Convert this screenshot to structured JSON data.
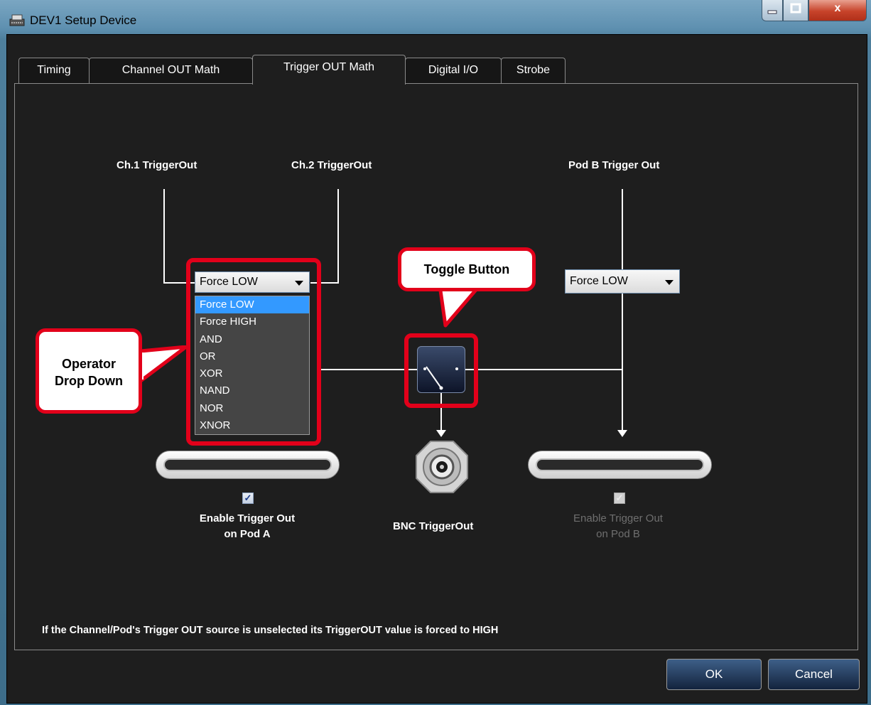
{
  "window": {
    "title": "DEV1 Setup Device",
    "close_label": "x"
  },
  "tabs": [
    {
      "label": "Timing"
    },
    {
      "label": "Channel OUT Math"
    },
    {
      "label": "Trigger OUT Math"
    },
    {
      "label": "Digital I/O"
    },
    {
      "label": "Strobe"
    }
  ],
  "active_tab": "Trigger OUT Math",
  "diagram": {
    "ch1_label": "Ch.1 TriggerOut",
    "ch2_label": "Ch.2 TriggerOut",
    "podb_label": "Pod B Trigger Out",
    "pod_a_operator": {
      "selected": "Force LOW",
      "options": [
        "Force LOW",
        "Force HIGH",
        "AND",
        "OR",
        "XOR",
        "NAND",
        "NOR",
        "XNOR"
      ]
    },
    "pod_b_operator": {
      "selected": "Force LOW"
    },
    "bnc_label": "BNC TriggerOut",
    "pod_a_enable": {
      "line1": "Enable Trigger Out",
      "line2": "on Pod A",
      "checked": true
    },
    "pod_b_enable": {
      "line1": "Enable Trigger Out",
      "line2": "on Pod B",
      "checked": true,
      "disabled": true
    }
  },
  "callouts": {
    "toggle": "Toggle Button",
    "operator_line1": "Operator",
    "operator_line2": "Drop Down"
  },
  "note": "If the Channel/Pod's  Trigger OUT source is unselected its TriggerOUT value is forced to HIGH",
  "buttons": {
    "ok": "OK",
    "cancel": "Cancel"
  },
  "colors": {
    "highlight": "#e2001a",
    "selection": "#3399ff",
    "background": "#1e1e1e"
  },
  "icons": [
    "device-setup-icon",
    "minimize-icon",
    "maximize-icon",
    "close-icon",
    "dropdown-arrow-icon",
    "bnc-connector-icon",
    "pod-connector-icon",
    "checkmark-icon"
  ]
}
